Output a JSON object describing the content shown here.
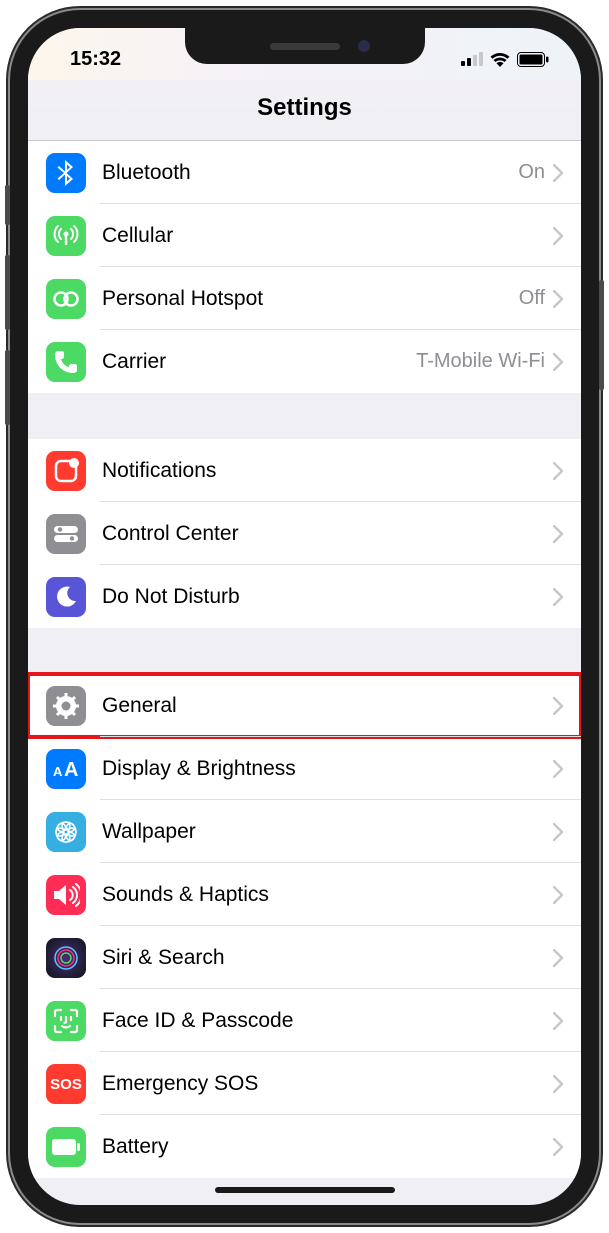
{
  "status": {
    "time": "15:32"
  },
  "header": {
    "title": "Settings"
  },
  "rows": [
    {
      "label": "Bluetooth",
      "value": "On"
    },
    {
      "label": "Cellular",
      "value": ""
    },
    {
      "label": "Personal Hotspot",
      "value": "Off"
    },
    {
      "label": "Carrier",
      "value": "T-Mobile Wi-Fi"
    },
    {
      "label": "Notifications",
      "value": ""
    },
    {
      "label": "Control Center",
      "value": ""
    },
    {
      "label": "Do Not Disturb",
      "value": ""
    },
    {
      "label": "General",
      "value": ""
    },
    {
      "label": "Display & Brightness",
      "value": ""
    },
    {
      "label": "Wallpaper",
      "value": ""
    },
    {
      "label": "Sounds & Haptics",
      "value": ""
    },
    {
      "label": "Siri & Search",
      "value": ""
    },
    {
      "label": "Face ID & Passcode",
      "value": ""
    },
    {
      "label": "Emergency SOS",
      "value": ""
    },
    {
      "label": "Battery",
      "value": ""
    }
  ]
}
